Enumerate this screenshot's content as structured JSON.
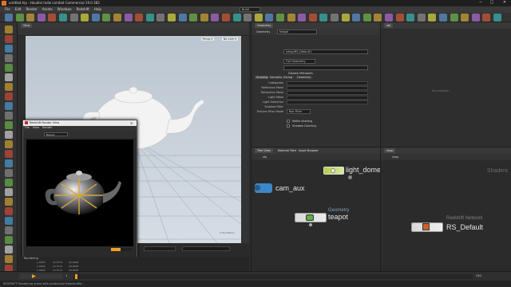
{
  "titlebar": {
    "title": "untitled.hip - Houdini Indie Limited Commercial 19.0.383",
    "minimize": "─",
    "maximize": "□",
    "close": "✕"
  },
  "menubar": {
    "items": [
      "File",
      "Edit",
      "Render",
      "Assets",
      "Windows",
      "Redshift",
      "Help"
    ],
    "desktop": "Build"
  },
  "viewport": {
    "tab": "View",
    "camera_label": "Persp ▾",
    "cam_label": "No cam ▾",
    "corner_text": "Indie Edition"
  },
  "render_view": {
    "title": "Redshift Render View",
    "menu": [
      "File",
      "View",
      "Render"
    ],
    "dropdown": "Beauty",
    "status_label": "Rendering",
    "rows": [
      [
        "1.0000",
        "12.5711",
        "16.0000"
      ],
      [
        "1.0000",
        "12.5711",
        "16.0000"
      ],
      [
        "1.0000",
        "12.5711",
        "16.0000"
      ]
    ]
  },
  "params": {
    "tab": "Geometry",
    "node_type": "Geometry",
    "node_name": "teapot",
    "fields": {
      "material": "/shop/RS_Default1",
      "display_as": "Full Geometry",
      "render_visibility": "",
      "use_metaballs": "Disable Metaballs"
    },
    "subtabs": [
      "Shading",
      "Sampling",
      "Dicing",
      "Geometry"
    ],
    "labels": [
      "Categories",
      "Reflection Mask",
      "Refraction Mask",
      "Light Mask",
      "Light Selection",
      "Shadow Filter",
      "Texture Filter Mode"
    ],
    "filter_value": "Box Filter",
    "checkboxes": [
      "Matte shading",
      "Shadow Catching"
    ]
  },
  "right_panel": {
    "tab": "obj",
    "empty_text": "No selection"
  },
  "network": {
    "tabs": [
      "Tree View",
      "Material Palette",
      "Asset Browser"
    ],
    "path": "obj",
    "nodes": [
      {
        "label": "light_dome",
        "type": ""
      },
      {
        "label": "cam_aux",
        "type": ""
      },
      {
        "label": "teapot",
        "type": "Geometry"
      }
    ]
  },
  "shaders": {
    "tab": "shop",
    "path": "shop",
    "header_label": "Shaders",
    "node": {
      "label": "RS_Default",
      "type": "Redshift Network"
    }
  },
  "timeline": {
    "start": "1",
    "end": "240",
    "current": "1",
    "fields": [
      "Linear",
      "Indirect"
    ]
  },
  "statusbar": {
    "text": "REDSHIFT: Rendering scene with production framebuffer..."
  },
  "colors": {
    "accent": "#f0a020",
    "node_blue": "#3b88c8",
    "node_green": "#b0d040",
    "viewport_sky": "#c9d3dd"
  }
}
